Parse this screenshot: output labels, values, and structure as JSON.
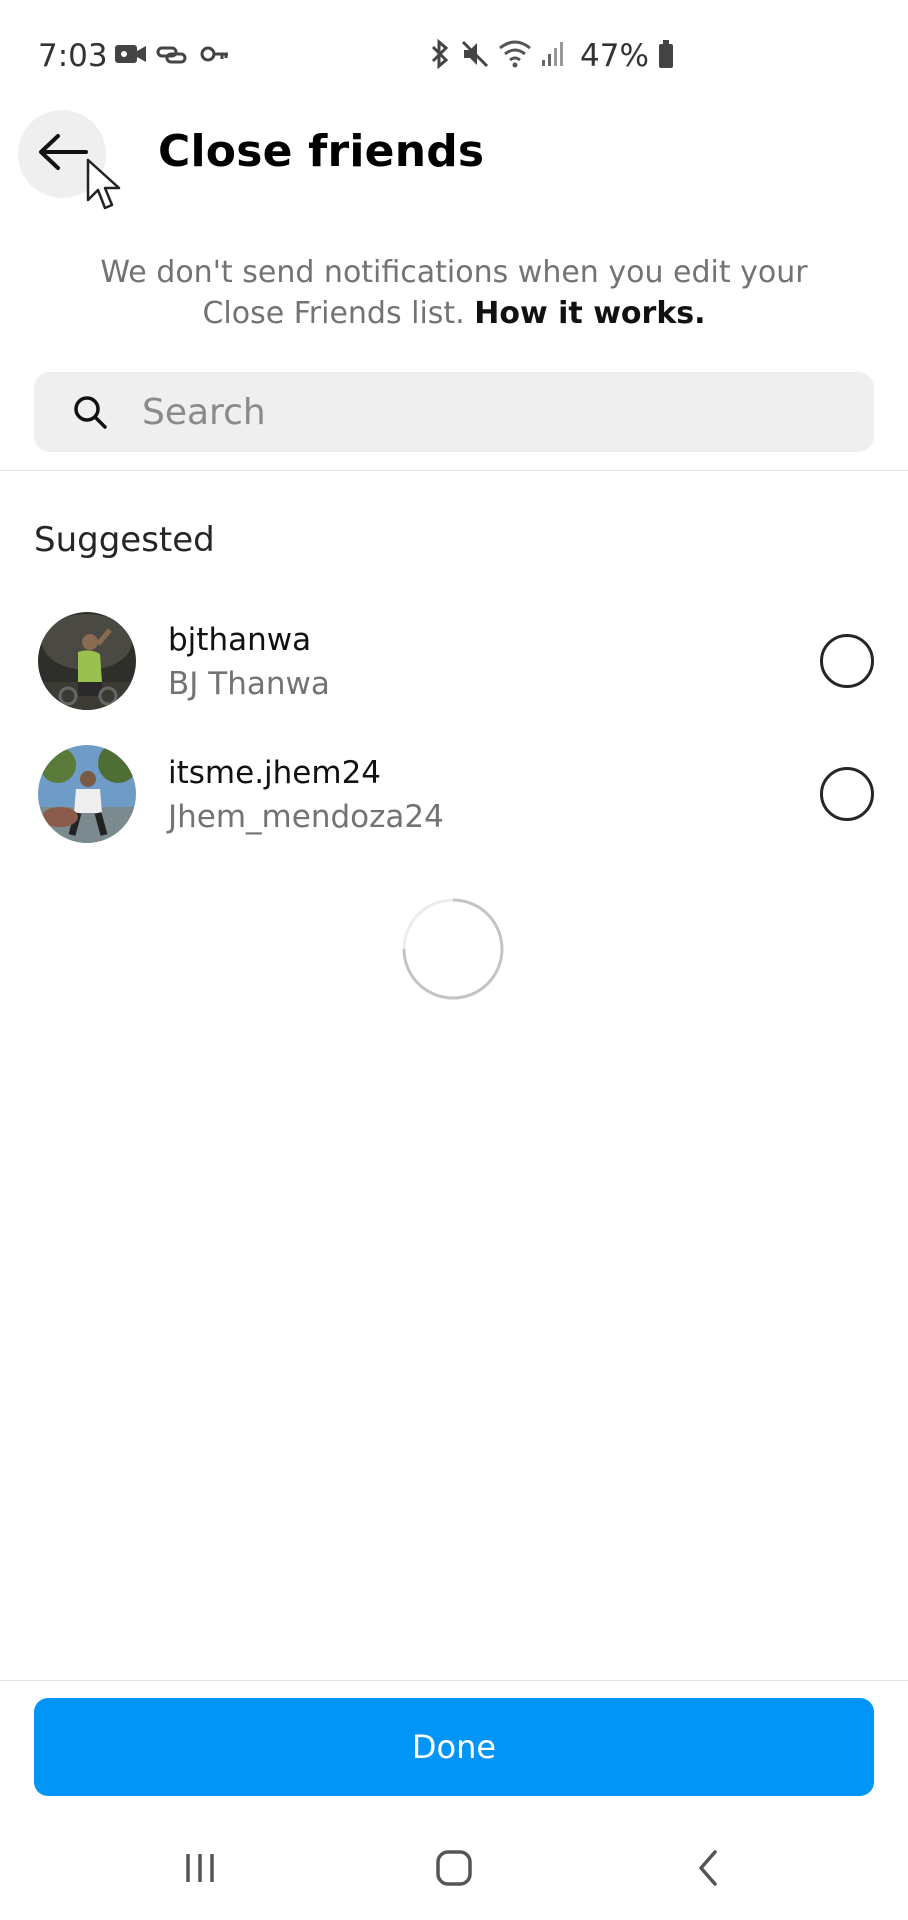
{
  "status_bar": {
    "time": "7:03",
    "battery": "47%",
    "icons": [
      "video-camera-icon",
      "link-icon",
      "key-icon",
      "bluetooth-icon",
      "mute-icon",
      "wifi-icon",
      "signal-icon",
      "battery-icon"
    ]
  },
  "header": {
    "title": "Close friends",
    "back_icon": "arrow-left-icon"
  },
  "info": {
    "text": "We don't send notifications when you edit your Close Friends list.",
    "link": "How it works."
  },
  "search": {
    "placeholder": "Search",
    "value": ""
  },
  "suggested": {
    "title": "Suggested",
    "users": [
      {
        "username": "bjthanwa",
        "full_name": "BJ Thanwa",
        "selected": false
      },
      {
        "username": "itsme.jhem24",
        "full_name": "Jhem_mendoza24",
        "selected": false
      }
    ]
  },
  "done_label": "Done",
  "nav": {
    "icons": [
      "recent-apps-icon",
      "home-icon",
      "back-nav-icon"
    ]
  },
  "colors": {
    "accent": "#0095f6",
    "secondary_text": "#737373",
    "search_bg": "#efefef"
  }
}
